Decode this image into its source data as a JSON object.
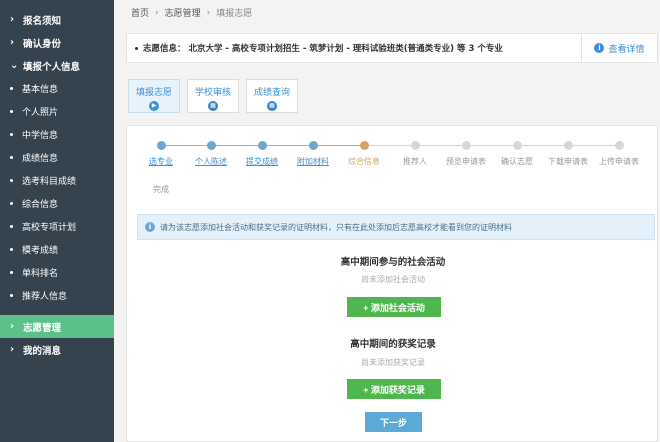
{
  "sidebar": {
    "top_items": [
      {
        "label": "报名须知"
      },
      {
        "label": "确认身份"
      },
      {
        "label": "填报个人信息"
      }
    ],
    "sub_items": [
      {
        "label": "基本信息"
      },
      {
        "label": "个人照片"
      },
      {
        "label": "中学信息"
      },
      {
        "label": "成绩信息"
      },
      {
        "label": "选考科目成绩"
      },
      {
        "label": "综合信息"
      },
      {
        "label": "高校专项计划"
      },
      {
        "label": "模考成绩"
      },
      {
        "label": "单科排名"
      },
      {
        "label": "推荐人信息"
      }
    ],
    "bottom_items": [
      {
        "label": "志愿管理",
        "active": true
      },
      {
        "label": "我的消息"
      }
    ],
    "active_color": "#5cc08a",
    "bg_color": "#35434f"
  },
  "breadcrumb": {
    "home": "首页",
    "section": "志愿管理",
    "current": "填报志愿"
  },
  "info_bar": {
    "text": "志愿信息： 北京大学 - 高校专项计划招生 - 筑梦计划 - 理科试验班类(普通类专业) 等 3 个专业",
    "detail_label": "查看详情"
  },
  "tabs": [
    {
      "label": "填报志愿",
      "active": true
    },
    {
      "label": "学校审核"
    },
    {
      "label": "成绩查询"
    }
  ],
  "steps": [
    {
      "label": "选专业",
      "state": "done"
    },
    {
      "label": "个人陈述",
      "state": "done"
    },
    {
      "label": "提交成绩",
      "state": "done"
    },
    {
      "label": "附加材料",
      "state": "done"
    },
    {
      "label": "综合信息",
      "state": "current"
    },
    {
      "label": "推荐人",
      "state": "todo"
    },
    {
      "label": "预览申请表",
      "state": "todo"
    },
    {
      "label": "确认志愿",
      "state": "todo"
    },
    {
      "label": "下载申请表",
      "state": "todo"
    },
    {
      "label": "上传申请表",
      "state": "todo"
    },
    {
      "label": "完成",
      "state": "todo"
    }
  ],
  "notice": "请为该志愿添加社会活动和获奖记录的证明材料，只有在此处添加后志愿高校才能看到您的证明材料",
  "social": {
    "title": "高中期间参与的社会活动",
    "empty": "尚未添加社会活动",
    "button": "+ 添加社会活动"
  },
  "awards": {
    "title": "高中期间的获奖记录",
    "empty": "尚未添加获奖记录",
    "button": "+ 添加获奖记录"
  },
  "next_button": "下一步",
  "colors": {
    "link_blue": "#3a8fd6",
    "green_button": "#4fb64f",
    "next_button": "#5aaad8",
    "current_step": "#d9a45a"
  }
}
